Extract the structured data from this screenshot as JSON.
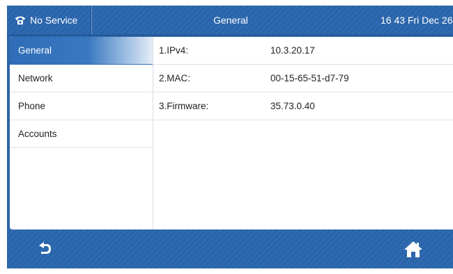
{
  "status": {
    "service_label": "No Service",
    "service_icon": "phone-icon"
  },
  "header": {
    "title": "General",
    "clock": "16 43 Fri Dec 26"
  },
  "sidebar": {
    "items": [
      {
        "label": "General",
        "active": true
      },
      {
        "label": "Network",
        "active": false
      },
      {
        "label": "Phone",
        "active": false
      },
      {
        "label": "Accounts",
        "active": false
      }
    ]
  },
  "info": {
    "rows": [
      {
        "label": "1.IPv4:",
        "value": "10.3.20.17"
      },
      {
        "label": "2.MAC:",
        "value": "00-15-65-51-d7-79"
      },
      {
        "label": "3.Firmware:",
        "value": "35.73.0.40"
      }
    ]
  },
  "bottom": {
    "back_icon": "back-arrow-icon",
    "home_icon": "home-icon"
  },
  "colors": {
    "bar_blue": "#2c65a8",
    "active_blue": "#2f6db8",
    "text": "#222222"
  }
}
